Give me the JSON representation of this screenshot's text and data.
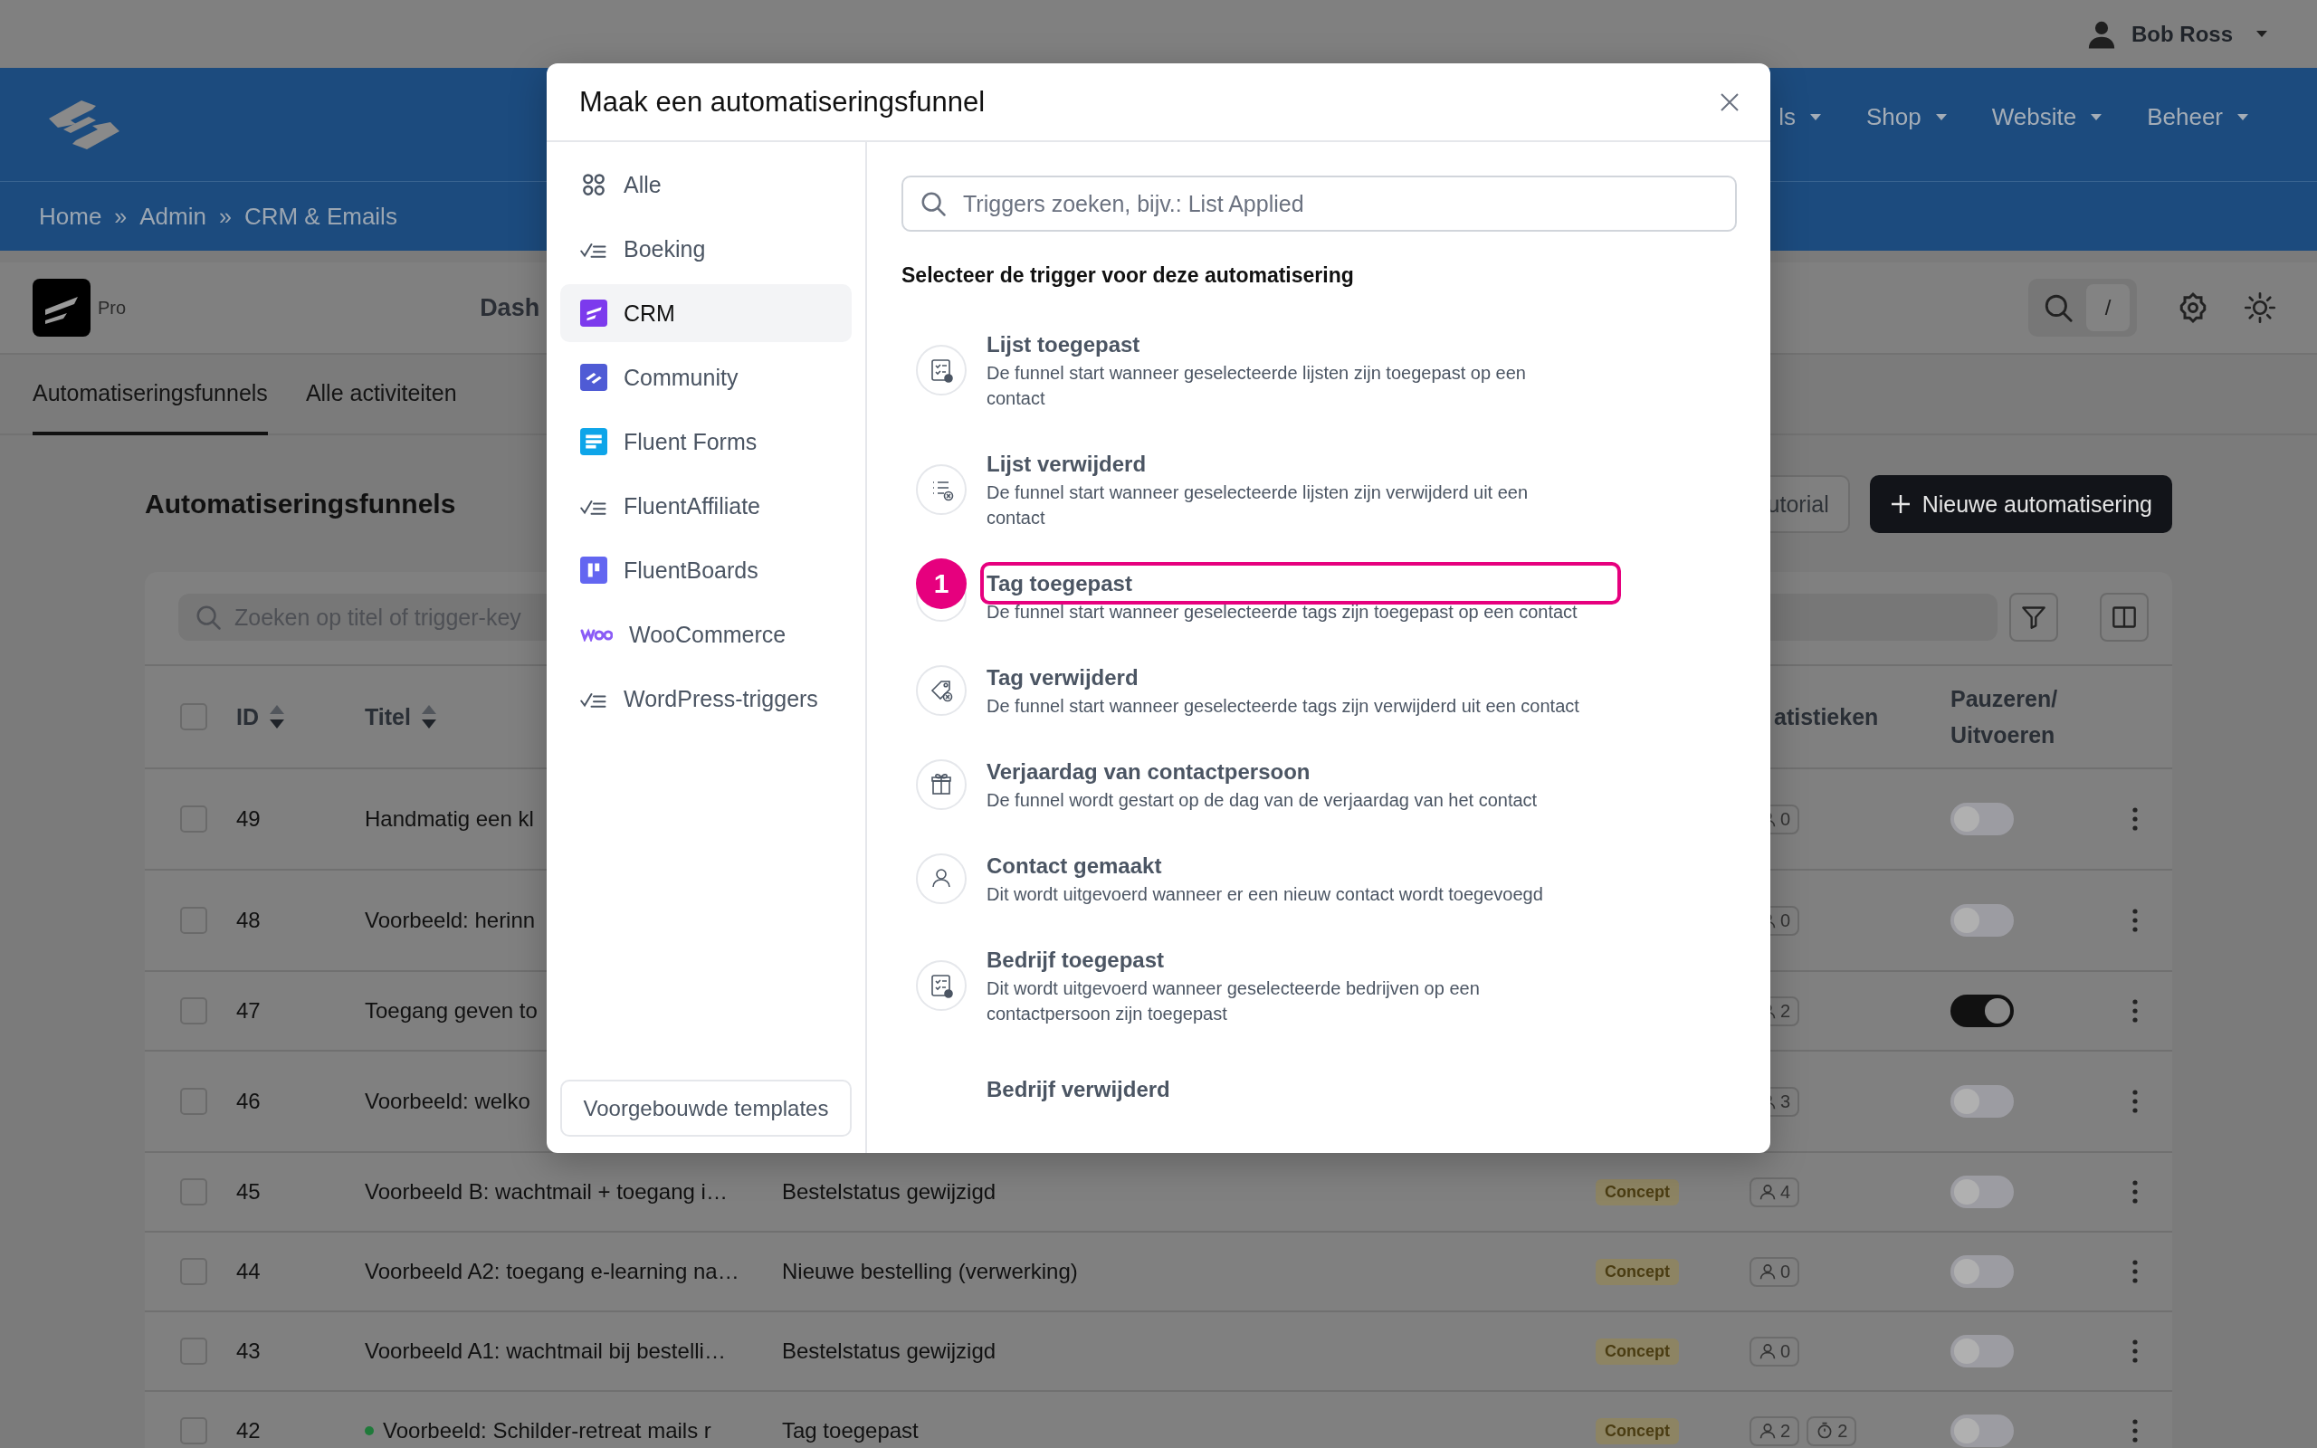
{
  "top_bar": {
    "user_name": "Bob Ross"
  },
  "main_nav": [
    {
      "label": "ls"
    },
    {
      "label": "Shop"
    },
    {
      "label": "Website"
    },
    {
      "label": "Beheer"
    }
  ],
  "breadcrumb": [
    {
      "kind": "link",
      "text": "Home"
    },
    {
      "kind": "separator",
      "text": "»"
    },
    {
      "kind": "link",
      "text": "Admin"
    },
    {
      "kind": "separator",
      "text": "»"
    },
    {
      "kind": "link",
      "text": "CRM & Emails"
    }
  ],
  "app_header": {
    "edition": "Pro",
    "menu": [
      "Dash"
    ],
    "search_shortcut": "/"
  },
  "tabs": [
    {
      "label": "Automatiseringsfunnels",
      "selected": true
    },
    {
      "label": "Alle activiteiten",
      "selected": false
    }
  ],
  "page": {
    "title": "Automatiseringsfunnels",
    "buttons": [
      {
        "kind": "outline",
        "label": "utorial"
      },
      {
        "kind": "primary",
        "label": "Nieuwe automatisering"
      }
    ]
  },
  "table": {
    "search": {
      "placeholder": "Zoeken op titel of trigger-key"
    },
    "all_checked": false,
    "columns": [
      {
        "label": "ID",
        "sortable": true
      },
      {
        "label": "Titel",
        "sortable": true
      },
      {
        "label": "atistieken",
        "sortable": false
      },
      {
        "label": "Pauzeren/Uitvoeren",
        "sortable": false
      }
    ],
    "rows": [
      {
        "id": "49",
        "checked": false,
        "title": "Handmatig een kl",
        "stats": [
          {
            "kind": "contacts",
            "value": "0"
          }
        ],
        "on": false
      },
      {
        "id": "48",
        "checked": false,
        "title": "Voorbeeld: herinn",
        "stats": [
          {
            "kind": "contacts",
            "value": "0"
          }
        ],
        "on": false
      },
      {
        "id": "47",
        "checked": false,
        "title": "Toegang geven to",
        "stats": [
          {
            "kind": "contacts",
            "value": "2"
          }
        ],
        "on": true
      },
      {
        "id": "46",
        "checked": false,
        "title": "Voorbeeld: welko",
        "stats": [
          {
            "kind": "contacts",
            "value": "3"
          }
        ],
        "on": false
      },
      {
        "id": "45",
        "checked": false,
        "title": "Voorbeeld B: wachtmail + toegang i…",
        "trigger": "Bestelstatus gewijzigd",
        "status": "Concept",
        "stats": [
          {
            "kind": "contacts",
            "value": "4"
          }
        ],
        "on": false
      },
      {
        "id": "44",
        "checked": false,
        "title": "Voorbeeld A2: toegang e-learning na…",
        "trigger": "Nieuwe bestelling (verwerking)",
        "status": "Concept",
        "stats": [
          {
            "kind": "contacts",
            "value": "0"
          }
        ],
        "on": false
      },
      {
        "id": "43",
        "checked": false,
        "title": "Voorbeeld A1: wachtmail bij bestelli…",
        "trigger": "Bestelstatus gewijzigd",
        "status": "Concept",
        "stats": [
          {
            "kind": "contacts",
            "value": "0"
          }
        ],
        "on": false
      },
      {
        "id": "42",
        "checked": false,
        "title": "Voorbeeld: Schilder-retreat mails r",
        "color": "#1f7a3a",
        "trigger": "Tag toegepast",
        "status": "Concept",
        "stats": [
          {
            "kind": "contacts",
            "value": "2"
          },
          {
            "kind": "timer",
            "value": "2"
          }
        ],
        "on": false
      }
    ]
  },
  "modal": {
    "title": "Maak een automatiseringsfunnel",
    "categories": [
      {
        "label": "Alle",
        "selected": false
      },
      {
        "label": "Boeking",
        "selected": false
      },
      {
        "label": "CRM",
        "selected": true
      },
      {
        "label": "Community",
        "selected": false
      },
      {
        "label": "Fluent Forms",
        "selected": false
      },
      {
        "label": "FluentAffiliate",
        "selected": false
      },
      {
        "label": "FluentBoards",
        "selected": false
      },
      {
        "label": "WooCommerce",
        "selected": false
      },
      {
        "label": "WordPress-triggers",
        "selected": false
      }
    ],
    "templates_button": "Voorgebouwde templates",
    "search_placeholder": "Triggers zoeken, bijv.: List Applied",
    "heading": "Selecteer de trigger voor deze automatisering",
    "step_badge": "1",
    "triggers": [
      {
        "title": "Lijst toegepast",
        "description": "De funnel start wanneer geselecteerde lijsten zijn toegepast op een contact",
        "highlighted": false
      },
      {
        "title": "Lijst verwijderd",
        "description": "De funnel start wanneer geselecteerde lijsten zijn verwijderd uit een contact",
        "highlighted": false
      },
      {
        "title": "Tag toegepast",
        "description": "De funnel start wanneer geselecteerde tags zijn toegepast op een contact",
        "highlighted": true
      },
      {
        "title": "Tag verwijderd",
        "description": "De funnel start wanneer geselecteerde tags zijn verwijderd uit een contact",
        "highlighted": false
      },
      {
        "title": "Verjaardag van contactpersoon",
        "description": "De funnel wordt gestart op de dag van de verjaardag van het contact",
        "highlighted": false
      },
      {
        "title": "Contact gemaakt",
        "description": "Dit wordt uitgevoerd wanneer er een nieuw contact wordt toegevoegd",
        "highlighted": false
      },
      {
        "title": "Bedrijf toegepast",
        "description": "Dit wordt uitgevoerd wanneer geselecteerde bedrijven op een contactpersoon zijn toegepast",
        "highlighted": false
      },
      {
        "title": "Bedrijf verwijderd",
        "highlighted": false
      }
    ]
  }
}
